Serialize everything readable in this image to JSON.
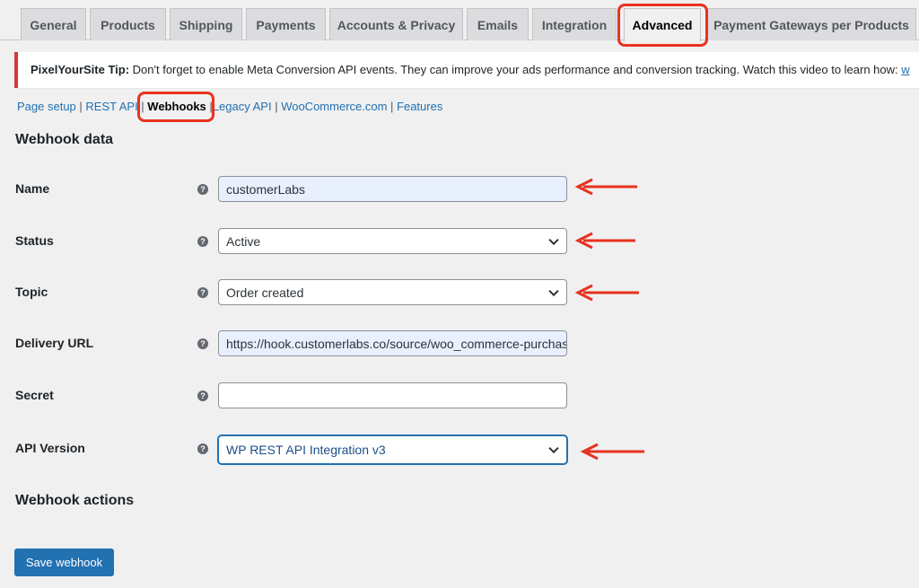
{
  "tabs": [
    {
      "label": "General"
    },
    {
      "label": "Products"
    },
    {
      "label": "Shipping"
    },
    {
      "label": "Payments"
    },
    {
      "label": "Accounts & Privacy"
    },
    {
      "label": "Emails"
    },
    {
      "label": "Integration"
    },
    {
      "label": "Advanced",
      "active": true
    },
    {
      "label": "Payment Gateways per Products"
    }
  ],
  "notice": {
    "title": "PixelYourSite Tip:",
    "text": " Don't forget to enable Meta Conversion API events. They can improve your ads performance and conversion tracking. Watch this video to learn how: ",
    "link": "w"
  },
  "subnav": {
    "page_setup": "Page setup",
    "sep1": " | ",
    "rest_api": "REST API",
    "sep2": " | ",
    "webhooks": "Webhooks",
    "sep3": " |",
    "legacy_api": "Legacy API",
    "sep4": " | ",
    "woocommerce_com": "WooCommerce.com",
    "sep5": " | ",
    "features": "Features"
  },
  "webhook_data": {
    "heading": "Webhook data",
    "name_label": "Name",
    "name_value": "customerLabs",
    "status_label": "Status",
    "status_value": "Active",
    "topic_label": "Topic",
    "topic_value": "Order created",
    "delivery_label": "Delivery URL",
    "delivery_value": "https://hook.customerlabs.co/source/woo_commerce-purchase",
    "secret_label": "Secret",
    "secret_value": "",
    "api_label": "API Version",
    "api_value": "WP REST API Integration v3",
    "help_glyph": "?"
  },
  "webhook_actions": {
    "heading": "Webhook actions",
    "save_label": "Save webhook"
  },
  "colors": {
    "annotation_red": "#e8321e",
    "primary_blue": "#2271b1",
    "notice_red": "#d63638"
  }
}
